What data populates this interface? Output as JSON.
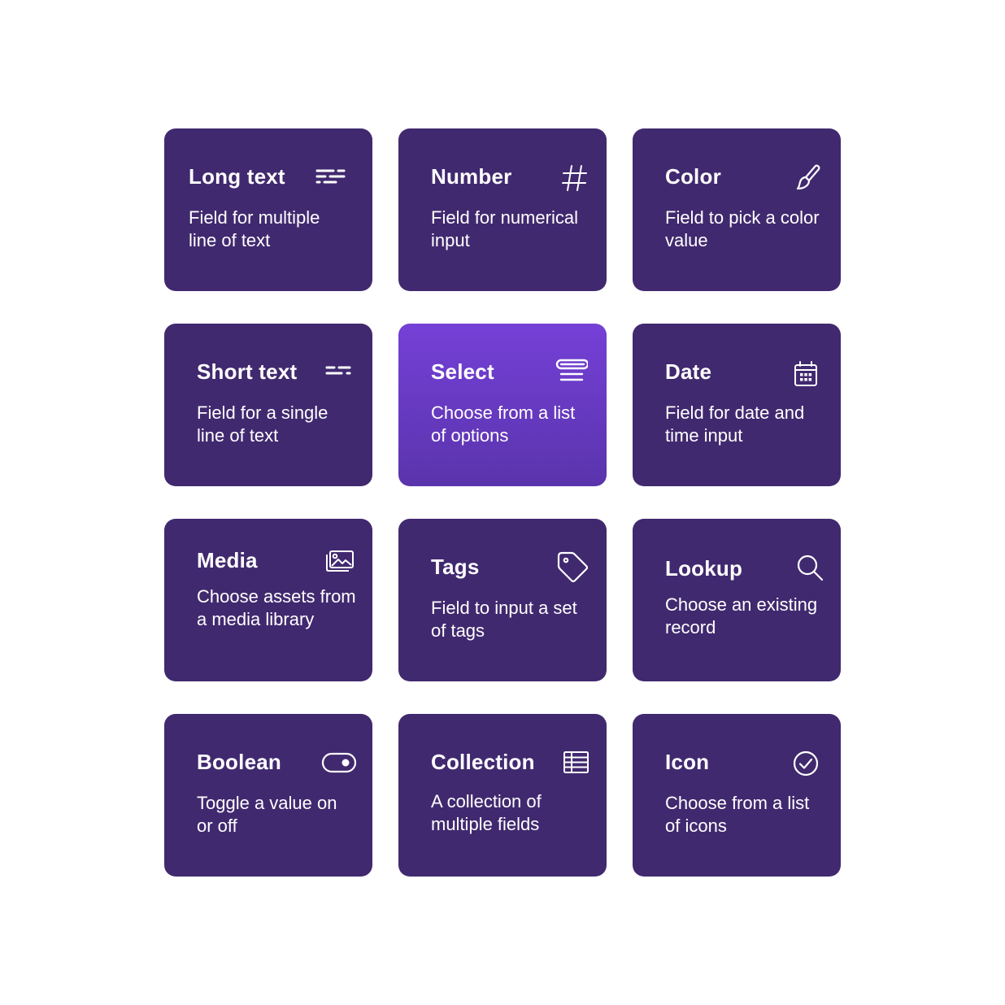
{
  "colors": {
    "background": "#FFFFFF",
    "card": "#41296F",
    "card_active_top": "#7540D7",
    "card_active_bottom": "#5A34AC",
    "text": "#FFFFFF"
  },
  "cards": [
    {
      "title": "Long text",
      "description": "Field for multiple line of text",
      "icon": "long-text-icon",
      "active": false
    },
    {
      "title": "Number",
      "description": "Field for numerical input",
      "icon": "hash-icon",
      "active": false
    },
    {
      "title": "Color",
      "description": "Field to pick a color value",
      "icon": "paintbrush-icon",
      "active": false
    },
    {
      "title": "Short text",
      "description": "Field for a single line of text",
      "icon": "short-text-icon",
      "active": false
    },
    {
      "title": "Select",
      "description": "Choose from a list of options",
      "icon": "select-list-icon",
      "active": true
    },
    {
      "title": "Date",
      "description": "Field for date and time input",
      "icon": "calendar-icon",
      "active": false
    },
    {
      "title": "Media",
      "description": "Choose assets from a media library",
      "icon": "image-gallery-icon",
      "active": false
    },
    {
      "title": "Tags",
      "description": "Field to input a set of tags",
      "icon": "tag-icon",
      "active": false
    },
    {
      "title": "Lookup",
      "description": "Choose an existing record",
      "icon": "search-icon",
      "active": false
    },
    {
      "title": "Boolean",
      "description": "Toggle a value on or off",
      "icon": "toggle-icon",
      "active": false
    },
    {
      "title": "Collection",
      "description": "A collection of multiple fields",
      "icon": "table-icon",
      "active": false
    },
    {
      "title": "Icon",
      "description": "Choose from a list of icons",
      "icon": "check-circle-icon",
      "active": false
    }
  ]
}
